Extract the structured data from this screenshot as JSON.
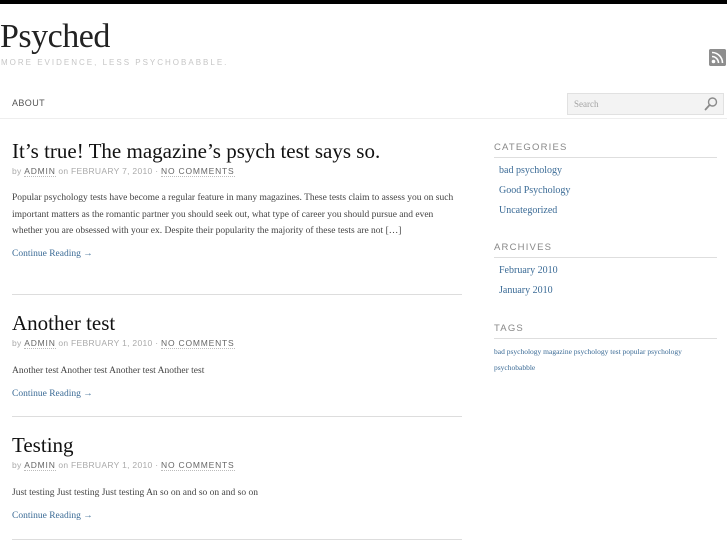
{
  "site": {
    "title": "Psyched",
    "tagline": "MORE EVIDENCE, LESS PSYCHOBABBLE."
  },
  "nav": {
    "about_label": "ABOUT",
    "search_placeholder": "Search"
  },
  "posts": [
    {
      "title": "It’s true! The magazine’s psych test says so.",
      "by": "by",
      "author": "ADMIN",
      "on": "on",
      "date": "FEBRUARY 7, 2010",
      "sep": "·",
      "comments": "NO COMMENTS",
      "excerpt": "Popular psychology tests have become a regular feature in many magazines. These tests claim to assess you on such important matters as the romantic partner you should seek out, what type of career you should pursue and even whether you are obsessed with your ex. Despite their popularity the majority of these tests are not […]",
      "continue": "Continue Reading →"
    },
    {
      "title": "Another test",
      "by": "by",
      "author": "ADMIN",
      "on": "on",
      "date": "FEBRUARY 1, 2010",
      "sep": "·",
      "comments": "NO COMMENTS",
      "excerpt": "Another test Another test Another test Another test",
      "continue": "Continue Reading →"
    },
    {
      "title": "Testing",
      "by": "by",
      "author": "ADMIN",
      "on": "on",
      "date": "FEBRUARY 1, 2010",
      "sep": "·",
      "comments": "NO COMMENTS",
      "excerpt": "Just testing Just testing Just testing An so on and so on and so on",
      "continue": "Continue Reading →"
    }
  ],
  "sidebar": {
    "categories": {
      "title": "CATEGORIES",
      "items": [
        "bad psychology",
        "Good Psychology",
        "Uncategorized"
      ]
    },
    "archives": {
      "title": "ARCHIVES",
      "items": [
        "February 2010",
        "January 2010"
      ]
    },
    "tags": {
      "title": "TAGS",
      "items": [
        "bad psychology",
        "magazine psychology test",
        "popular psychology",
        "psychobabble"
      ]
    }
  },
  "icons": {
    "rss": "rss-icon",
    "search": "search-icon"
  },
  "colors": {
    "link": "#3b6b96",
    "top_bar": "#000000",
    "muted": "#aaaaaa"
  }
}
